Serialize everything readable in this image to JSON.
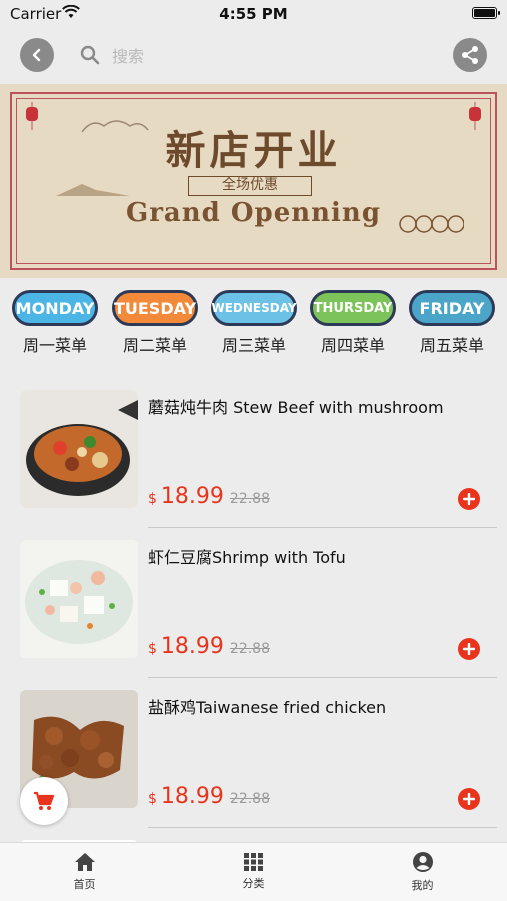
{
  "status_bar": {
    "carrier": "Carrier",
    "time": "4:55 PM"
  },
  "header": {
    "search_placeholder": "搜索",
    "icons": {
      "back": "chevron-left-icon",
      "search": "search-icon",
      "share": "share-icon"
    }
  },
  "banner": {
    "title_cn": "新店开业",
    "subtitle_cn": "全场优惠",
    "title_en": "Grand Openning"
  },
  "days": [
    {
      "badge": "MONDAY",
      "label": "周一菜单",
      "color": "#4bb6e6"
    },
    {
      "badge": "TUESDAY",
      "label": "周二菜单",
      "color": "#f28a3a"
    },
    {
      "badge": "WEDNESDAY",
      "label": "周三菜单",
      "color": "#6cc2e6"
    },
    {
      "badge": "THURSDAY",
      "label": "周四菜单",
      "color": "#7cc45a"
    },
    {
      "badge": "FRIDAY",
      "label": "周五菜单",
      "color": "#4aa5c8"
    }
  ],
  "menu": [
    {
      "name": "蘑菇炖牛肉 Stew Beef with mushroom",
      "currency": "$",
      "price": "18.99",
      "old_price": "22.88"
    },
    {
      "name": "虾仁豆腐Shrimp with Tofu",
      "currency": "$",
      "price": "18.99",
      "old_price": "22.88"
    },
    {
      "name": "盐酥鸡Taiwanese fried chicken",
      "currency": "$",
      "price": "18.99",
      "old_price": "22.88"
    }
  ],
  "tabs": [
    {
      "label": "首页",
      "icon": "home-icon"
    },
    {
      "label": "分类",
      "icon": "grid-icon"
    },
    {
      "label": "我的",
      "icon": "account-icon"
    }
  ],
  "colors": {
    "accent": "#e8341c",
    "banner_border": "#b9555a",
    "banner_text": "#6e4a2d"
  }
}
